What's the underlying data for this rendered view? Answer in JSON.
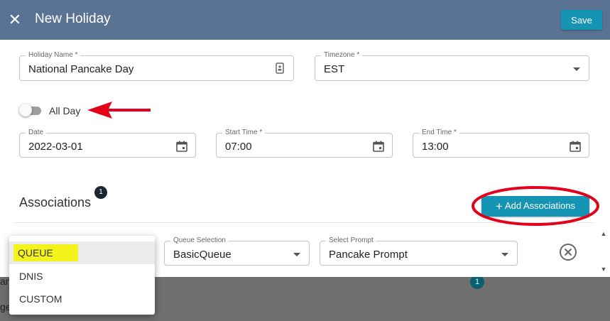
{
  "dialog": {
    "title": "New Holiday",
    "save_label": "Save"
  },
  "holiday_name": {
    "label": "Holiday Name *",
    "value": "National Pancake Day"
  },
  "timezone": {
    "label": "Timezone *",
    "value": "EST"
  },
  "all_day": {
    "label": "All Day",
    "enabled": false
  },
  "date": {
    "label": "Date",
    "value": "2022-03-01"
  },
  "start_time": {
    "label": "Start Time *",
    "value": "07:00"
  },
  "end_time": {
    "label": "End Time *",
    "value": "13:00"
  },
  "associations": {
    "title": "Associations",
    "count": "1",
    "add_label": "Add Associations",
    "queue_selection": {
      "label": "Queue Selection",
      "value": "BasicQueue"
    },
    "select_prompt": {
      "label": "Select Prompt",
      "value": "Pancake Prompt"
    }
  },
  "type_menu": {
    "options": [
      "QUEUE",
      "DNIS",
      "CUSTOM"
    ],
    "selected": "QUEUE"
  },
  "background": {
    "badge": "1",
    "fragment_1": "an",
    "fragment_2": "ge"
  },
  "colors": {
    "header": "#5a7393",
    "accent": "#1694b3",
    "annotation_red": "#e3001b",
    "highlight_yellow": "#f4f41c"
  }
}
